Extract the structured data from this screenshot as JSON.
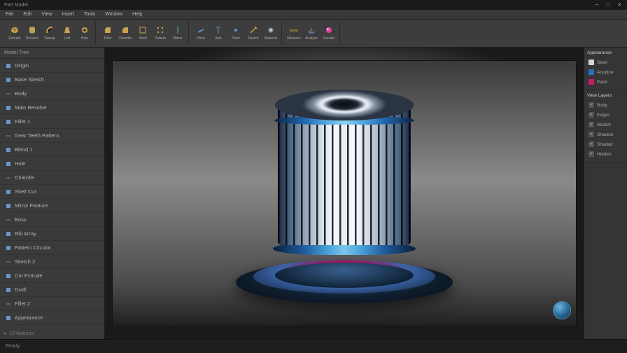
{
  "title": "Part Model",
  "menu": [
    "File",
    "Edit",
    "View",
    "Insert",
    "Tools",
    "Window",
    "Help"
  ],
  "ribbon": [
    {
      "icon": "cube",
      "label": "Extrude"
    },
    {
      "icon": "cylinder",
      "label": "Revolve"
    },
    {
      "icon": "sweep",
      "label": "Sweep"
    },
    {
      "icon": "loft",
      "label": "Loft"
    },
    {
      "icon": "hole",
      "label": "Hole"
    },
    {
      "icon": "fillet",
      "label": "Fillet"
    },
    {
      "icon": "chamfer",
      "label": "Chamfer"
    },
    {
      "icon": "shell",
      "label": "Shell"
    },
    {
      "icon": "pattern",
      "label": "Pattern"
    },
    {
      "icon": "mirror",
      "label": "Mirror"
    },
    {
      "icon": "plane",
      "label": "Plane"
    },
    {
      "icon": "axis",
      "label": "Axis"
    },
    {
      "icon": "point",
      "label": "Point"
    },
    {
      "icon": "sketch",
      "label": "Sketch"
    },
    {
      "icon": "material",
      "label": "Material"
    },
    {
      "icon": "measure",
      "label": "Measure"
    },
    {
      "icon": "analyze",
      "label": "Analyze"
    },
    {
      "icon": "render",
      "label": "Render"
    }
  ],
  "tree_header": "Model Tree",
  "tree": [
    "Origin",
    "Base Sketch",
    "Body",
    "Main Revolve",
    "Fillet 1",
    "Gear Teeth Pattern",
    "Blend 1",
    "Hole",
    "Chamfer",
    "Shell Cut",
    "Mirror Feature",
    "Boss",
    "Rib Array",
    "Pattern Circular",
    "Sketch 2",
    "Cut Extrude",
    "Draft",
    "Fillet 2",
    "Appearance"
  ],
  "tree_footer": "19 features",
  "right": {
    "section1_title": "Appearance",
    "items1": [
      {
        "color": "#d6d6d6",
        "label": "Steel"
      },
      {
        "color": "#2a6dc4",
        "label": "Anodize"
      },
      {
        "color": "#c81a6b",
        "label": "Paint"
      }
    ],
    "section2_title": "View Layers",
    "items2": [
      {
        "label": "Body"
      },
      {
        "label": "Edges"
      },
      {
        "label": "Sketch"
      },
      {
        "label": "Shadow"
      },
      {
        "label": "Shaded"
      },
      {
        "label": "Hidden"
      }
    ]
  },
  "status": "Ready"
}
